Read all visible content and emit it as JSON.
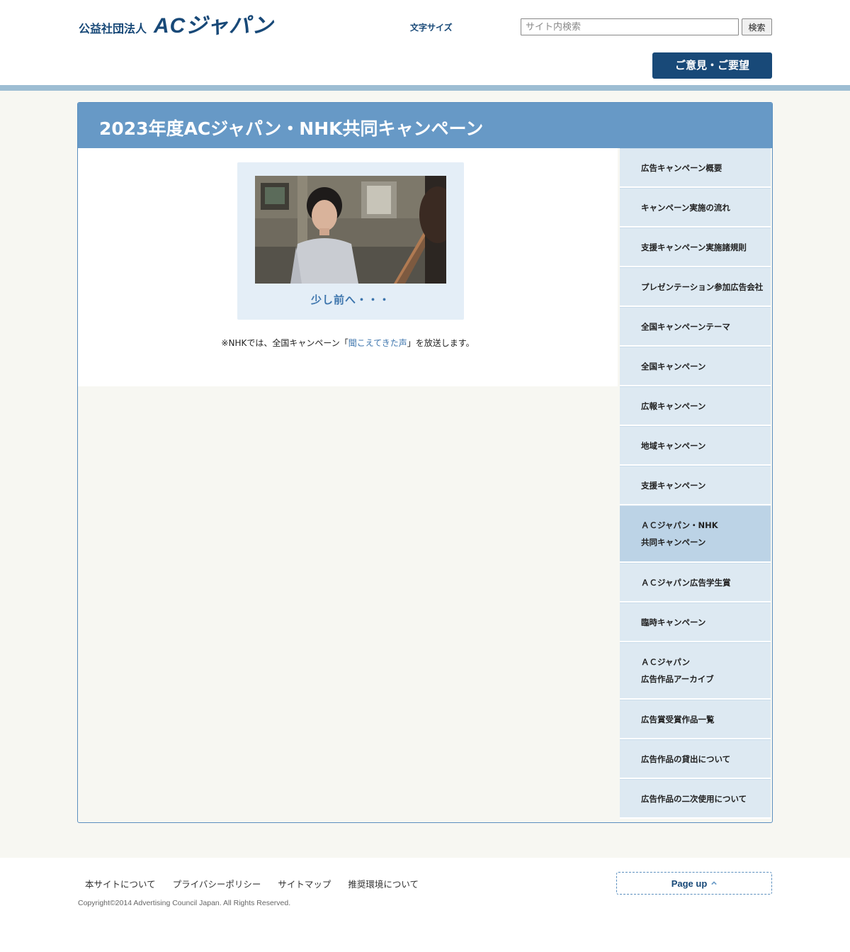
{
  "header": {
    "org_label": "公益社団法人",
    "logo_text": "ACジャパン",
    "font_size_label": "文字サイズ",
    "search": {
      "placeholder": "サイト内検索",
      "button_label": "検索"
    },
    "feedback_label": "ご意見・ご要望"
  },
  "page": {
    "title": "2023年度ACジャパン・NHK共同キャンペーン",
    "video": {
      "title": "少し前へ・・・"
    },
    "note": {
      "prefix": "※NHKでは、全国キャンペーン「",
      "link_text": "聞こえてきた声",
      "suffix": "」を放送します。"
    }
  },
  "side_nav": {
    "items": [
      {
        "lines": [
          "広告キャンペーン概要"
        ]
      },
      {
        "lines": [
          "キャンペーン実施の流れ"
        ]
      },
      {
        "lines": [
          "支援キャンペーン実施諸規則"
        ]
      },
      {
        "lines": [
          "プレゼンテーション参加広告会社"
        ]
      },
      {
        "lines": [
          "全国キャンペーンテーマ"
        ]
      },
      {
        "lines": [
          "全国キャンペーン"
        ]
      },
      {
        "lines": [
          "広報キャンペーン"
        ]
      },
      {
        "lines": [
          "地域キャンペーン"
        ]
      },
      {
        "lines": [
          "支援キャンペーン"
        ]
      },
      {
        "lines": [
          "ＡＣジャパン・NHK",
          "共同キャンペーン"
        ],
        "active": true
      },
      {
        "lines": [
          "ＡＣジャパン広告学生賞"
        ]
      },
      {
        "lines": [
          "臨時キャンペーン"
        ]
      },
      {
        "lines": [
          "ＡＣジャパン",
          "広告作品アーカイブ"
        ]
      },
      {
        "lines": [
          "広告賞受賞作品一覧"
        ]
      },
      {
        "lines": [
          "広告作品の貸出について"
        ]
      },
      {
        "lines": [
          "広告作品の二次使用について"
        ]
      }
    ]
  },
  "footer": {
    "links": [
      "本サイトについて",
      "プライバシーポリシー",
      "サイトマップ",
      "推奨環境について"
    ],
    "copyright": "Copyright©2014 Advertising Council Japan. All Rights Reserved.",
    "page_up_label": "Page up"
  },
  "colors": {
    "brand_navy": "#184978",
    "title_bar": "#6799c6",
    "nav_bg": "#dde9f2",
    "nav_active": "#bcd3e6",
    "link": "#3d75ad"
  }
}
